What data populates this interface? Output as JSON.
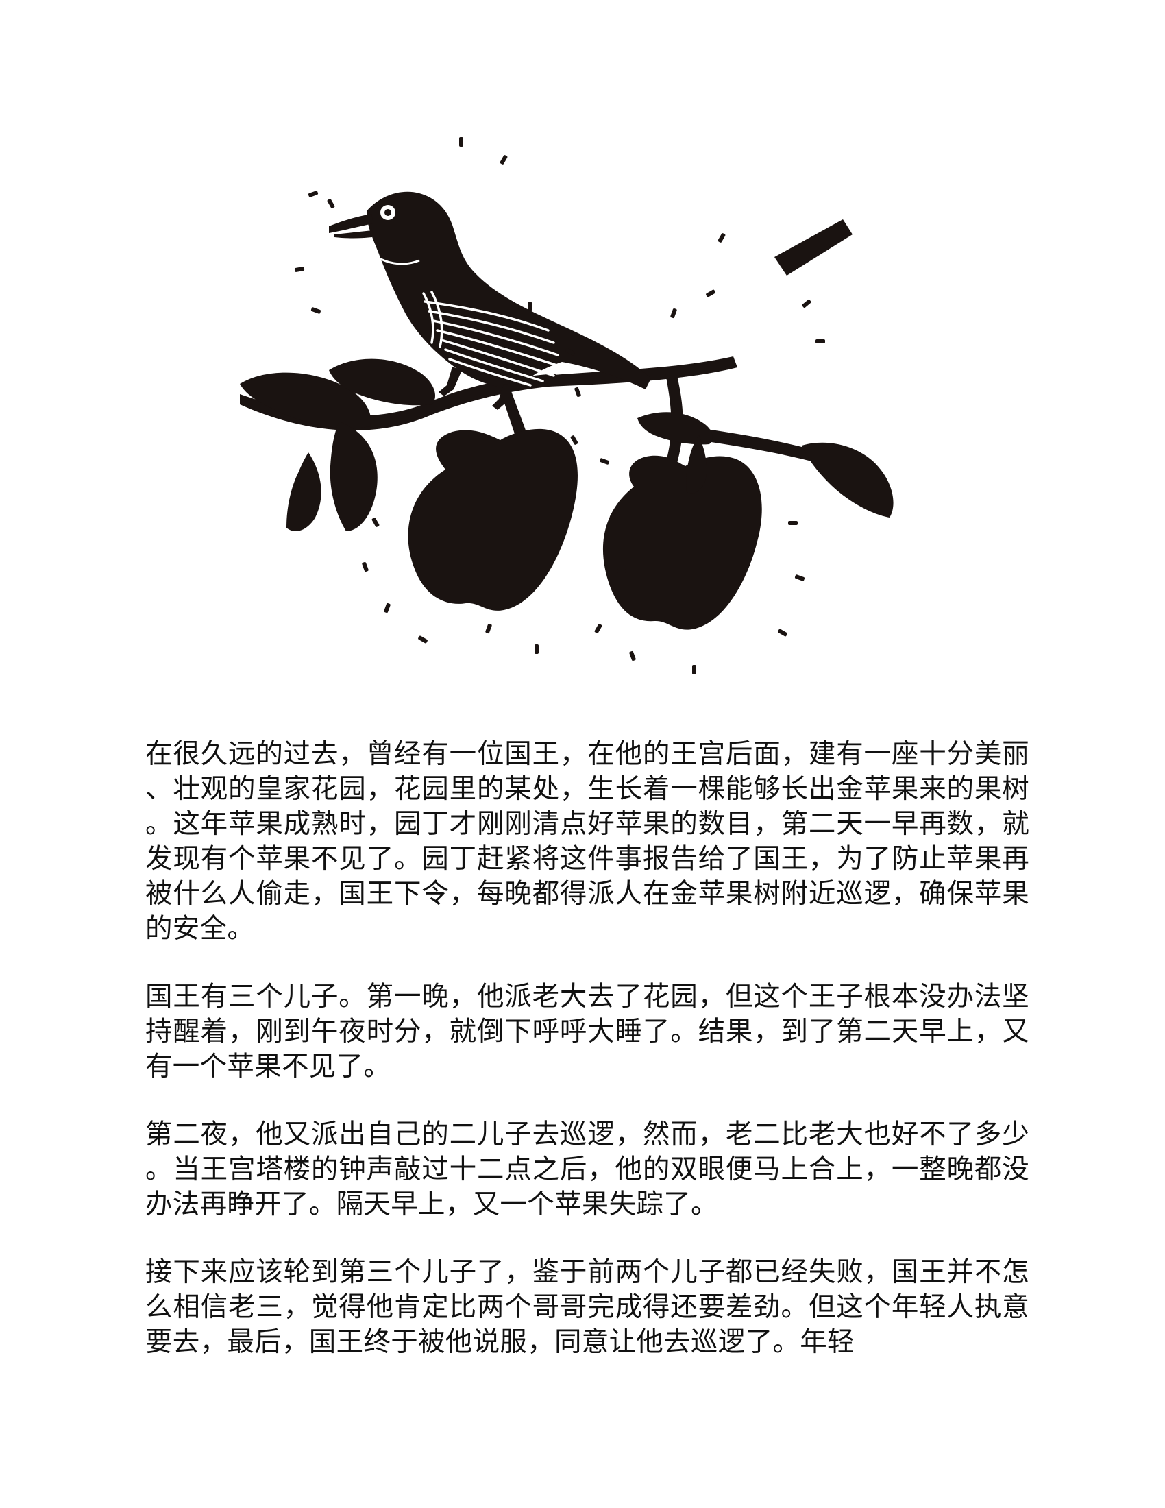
{
  "page": {
    "background_color": "#ffffff",
    "text_color": "#111111"
  },
  "illustration": {
    "icon": "bird-on-apple-branch-woodcut-icon",
    "ink_color": "#1a1311"
  },
  "story": {
    "paragraphs": [
      "在很久远的过去，曾经有一位国王，在他的王宫后面，建有一座十分美丽、壮观的皇家花园，花园里的某处，生长着一棵能够长出金苹果来的果树。这年苹果成熟时，园丁才刚刚清点好苹果的数目，第二天一早再数，就发现有个苹果不见了。园丁赶紧将这件事报告给了国王，为了防止苹果再被什么人偷走，国王下令，每晚都得派人在金苹果树附近巡逻，确保苹果的安全。",
      "国王有三个儿子。第一晚，他派老大去了花园，但这个王子根本没办法坚持醒着，刚到午夜时分，就倒下呼呼大睡了。结果，到了第二天早上，又有一个苹果不见了。",
      "第二夜，他又派出自己的二儿子去巡逻，然而，老二比老大也好不了多少。当王宫塔楼的钟声敲过十二点之后，他的双眼便马上合上，一整晚都没办法再睁开了。隔天早上，又一个苹果失踪了。",
      "接下来应该轮到第三个儿子了，鉴于前两个儿子都已经失败，国王并不怎么相信老三，觉得他肯定比两个哥哥完成得还要差劲。但这个年轻人执意要去，最后，国王终于被他说服，同意让他去巡逻了。年轻"
    ]
  }
}
